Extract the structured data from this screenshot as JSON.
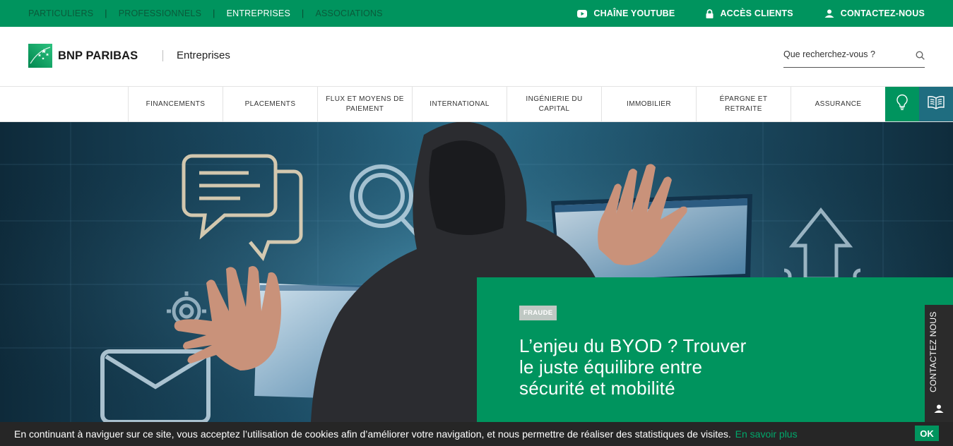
{
  "topbar": {
    "segments": [
      "PARTICULIERS",
      "PROFESSIONNELS",
      "ENTREPRISES",
      "ASSOCIATIONS"
    ],
    "active_segment": "ENTREPRISES",
    "separator": "|",
    "youtube": "CHAÎNE YOUTUBE",
    "client_access": "ACCÈS CLIENTS",
    "contact": "CONTACTEZ-NOUS",
    "color": "#00945e"
  },
  "header": {
    "brand": "BNP PARIBAS",
    "subtitle": "Entreprises",
    "search_placeholder": "Que recherchez-vous ?"
  },
  "nav": {
    "items": [
      "FINANCEMENTS",
      "PLACEMENTS",
      "FLUX ET MOYENS DE PAIEMENT",
      "INTERNATIONAL",
      "INGÉNIERIE DU CAPITAL",
      "IMMOBILIER",
      "ÉPARGNE ET RETRAITE",
      "ASSURANCE"
    ],
    "icons": [
      "lightbulb-icon",
      "book-icon"
    ]
  },
  "hero": {
    "tag": "FRAUDE",
    "title": "L’enjeu du BYOD ? Trouver le juste équilibre entre sécurité et mobilité",
    "contact_tab": "CONTACTEZ NOUS"
  },
  "cookie": {
    "text": "En continuant à naviguer sur ce site, vous acceptez l’utilisation de cookies afin d’améliorer votre navigation, et nous permettre de réaliser des statistiques de visites.",
    "link": "En savoir plus",
    "ok": "OK"
  }
}
